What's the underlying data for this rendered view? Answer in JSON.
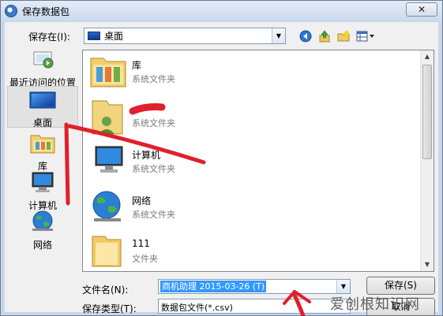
{
  "window": {
    "title": "保存数据包",
    "close_label": "✕"
  },
  "lookin": {
    "label": "保存在(I):",
    "value": "桌面"
  },
  "toolbar": {
    "icons": [
      "back-icon",
      "up-folder-icon",
      "new-folder-icon",
      "view-menu-icon"
    ]
  },
  "places": [
    {
      "label": "最近访问的位置",
      "icon": "recent-icon"
    },
    {
      "label": "桌面",
      "icon": "desktop-icon"
    },
    {
      "label": "库",
      "icon": "library-icon"
    },
    {
      "label": "计算机",
      "icon": "computer-icon"
    },
    {
      "label": "网络",
      "icon": "network-icon"
    }
  ],
  "files": [
    {
      "name": "库",
      "type": "系统文件夹",
      "icon": "library-icon"
    },
    {
      "name": "",
      "type": "系统文件夹",
      "icon": "user-folder-icon"
    },
    {
      "name": "计算机",
      "type": "系统文件夹",
      "icon": "computer-icon"
    },
    {
      "name": "网络",
      "type": "系统文件夹",
      "icon": "network-icon"
    },
    {
      "name": "111",
      "type": "文件夹",
      "icon": "folder-icon"
    }
  ],
  "filename": {
    "label": "文件名(N):",
    "value": "商机助理 2015-03-26 (T)"
  },
  "filetype": {
    "label": "保存类型(T):",
    "value": "数据包文件(*.csv)"
  },
  "buttons": {
    "save": "保存(S)",
    "cancel": "取消"
  },
  "watermark": "爱创根知识网",
  "colors": {
    "annotation": "#e0202a",
    "selection": "#3399ff"
  }
}
